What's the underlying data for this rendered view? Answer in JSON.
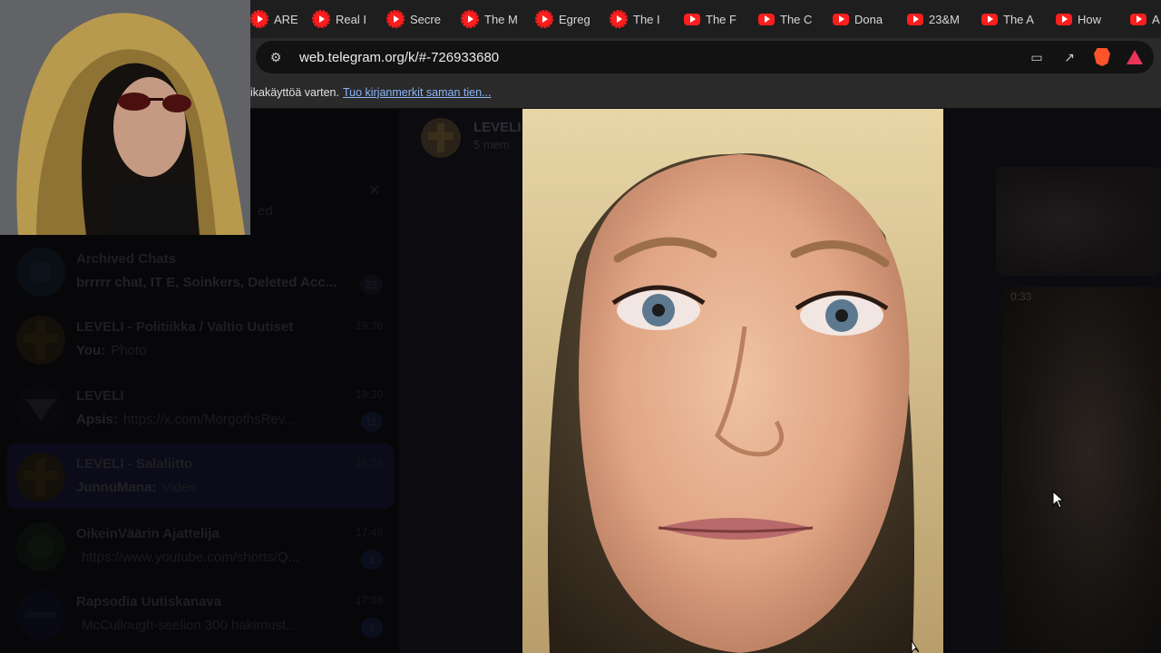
{
  "tabs": [
    {
      "label": "AREA",
      "icon": "youtube-icon-dotted"
    },
    {
      "label": "Real I",
      "icon": "youtube-icon-dotted"
    },
    {
      "label": "Secre",
      "icon": "youtube-icon-dotted"
    },
    {
      "label": "The M",
      "icon": "youtube-icon-dotted"
    },
    {
      "label": "Egreg",
      "icon": "youtube-icon-dotted"
    },
    {
      "label": "The I",
      "icon": "youtube-icon-dotted"
    },
    {
      "label": "The F",
      "icon": "youtube-icon"
    },
    {
      "label": "The C",
      "icon": "youtube-icon"
    },
    {
      "label": "Dona",
      "icon": "youtube-icon"
    },
    {
      "label": "23&M",
      "icon": "youtube-icon"
    },
    {
      "label": "The A",
      "icon": "youtube-icon"
    },
    {
      "label": "How",
      "icon": "youtube-icon"
    },
    {
      "label": "A",
      "icon": "youtube-icon"
    }
  ],
  "address": {
    "url": "web.telegram.org/k/#-726933680"
  },
  "bookmarks": {
    "text": "ikakäyttöä varten.",
    "link": "Tuo kirjanmerkit saman tien..."
  },
  "telegram": {
    "search_hint": "ed",
    "chats": [
      {
        "title": "Archived Chats",
        "preview_sender": "brrrrr chat, IT E, Soinkers, Deleted Acc...",
        "preview": "",
        "time": "",
        "badge": "22"
      },
      {
        "title": "LEVELI - Politiikka / Valtio Uutiset",
        "preview_sender": "You:",
        "preview": "Photo",
        "time": "19:36",
        "badge": ""
      },
      {
        "title": "LEVELI",
        "preview_sender": "Apsis:",
        "preview": "https://x.com/MorgothsRev...",
        "time": "19:30",
        "badge": "11"
      },
      {
        "title": "LEVELI - Salaliitto",
        "preview_sender": "JunnuMana:",
        "preview": "Video",
        "time": "18:24",
        "badge": ""
      },
      {
        "title": "OikeinVäärin Ajattelija",
        "preview_sender": "",
        "preview": "https://www.youtube.com/shorts/Q...",
        "time": "17:46",
        "badge": "1"
      },
      {
        "title": "Rapsodia Uutiskanava",
        "preview_sender": "",
        "preview": "McCullough-seelion 300 hakimust...",
        "time": "17:08",
        "badge": "1"
      }
    ],
    "header": {
      "title": "LEVELI",
      "subtitle": "5 mem"
    },
    "media_time": "0:33"
  },
  "colors": {
    "accent": "#8ab4f8",
    "youtube_red": "#ff1e1e",
    "active_chat": "#1a1a3a"
  }
}
